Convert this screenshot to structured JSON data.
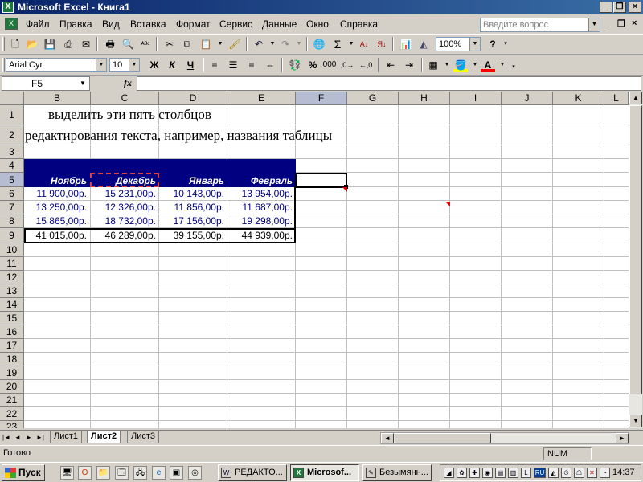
{
  "window": {
    "title": "Microsoft Excel - Книга1"
  },
  "menubar": {
    "items": [
      "Файл",
      "Правка",
      "Вид",
      "Вставка",
      "Формат",
      "Сервис",
      "Данные",
      "Окно",
      "Справка"
    ],
    "ask_placeholder": "Введите вопрос"
  },
  "toolbar_std": {
    "zoom": "100%"
  },
  "toolbar_fmt": {
    "font_name": "Arial Cyr",
    "font_size": "10",
    "bold": "Ж",
    "italic": "К",
    "underline": "Ч",
    "currency": "%",
    "thousands": "000"
  },
  "formula_bar": {
    "name_box": "F5",
    "fx": "fx",
    "formula": ""
  },
  "columns": [
    "B",
    "C",
    "D",
    "E",
    "F",
    "G",
    "H",
    "I",
    "J",
    "K",
    "L"
  ],
  "rows": [
    "1",
    "2",
    "3",
    "4",
    "5",
    "6",
    "7",
    "8",
    "9",
    "10",
    "11",
    "12",
    "13",
    "14",
    "15",
    "16",
    "17",
    "18",
    "19",
    "20",
    "21",
    "22",
    "23"
  ],
  "sheet": {
    "row1_text": "выделить эти пять столбцов",
    "row2_text": "редактирования текста, например, названия таблицы",
    "months": [
      "Ноябрь",
      "Декабрь",
      "Январь",
      "Февраль"
    ],
    "data": [
      [
        "11 900,00р.",
        "15 231,00р.",
        "10 143,00р.",
        "13 954,00р."
      ],
      [
        "13 250,00р.",
        "12 326,00р.",
        "11 856,00р.",
        "11 687,00р."
      ],
      [
        "15 865,00р.",
        "18 732,00р.",
        "17 156,00р.",
        "19 298,00р."
      ]
    ],
    "totals": [
      "41 015,00р.",
      "46 289,00р.",
      "39 155,00р.",
      "44 939,00р."
    ]
  },
  "sheet_tabs": [
    "Лист1",
    "Лист2",
    "Лист3"
  ],
  "active_tab": "Лист2",
  "status": {
    "text": "Готово",
    "num": "NUM"
  },
  "taskbar": {
    "start": "Пуск",
    "tasks": [
      "РЕДАКТО...",
      "Microsof...",
      "Безымянн..."
    ],
    "lang": "RU",
    "clock": "14:37"
  }
}
